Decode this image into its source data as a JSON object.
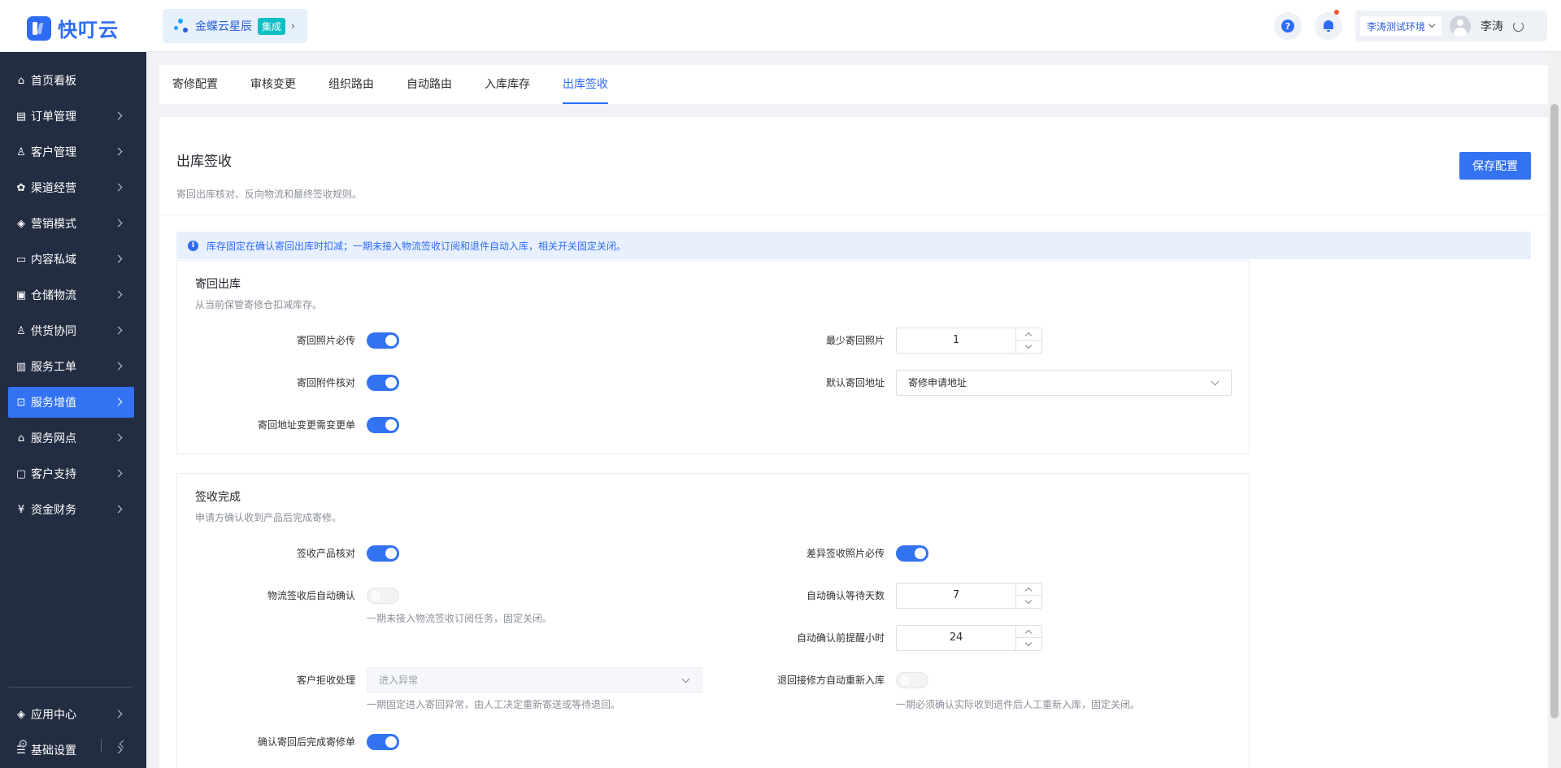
{
  "header": {
    "logo_text": "快叮云",
    "app_name": "金蝶云星辰",
    "app_tag": "集成",
    "env": "李涛测试环境",
    "user": "李涛",
    "colors": {
      "accent": "#3372f1",
      "sidebar_bg": "#232d42",
      "notify_dot": "#f5532d"
    }
  },
  "sidebar": {
    "items": [
      {
        "label": "首页看板",
        "icon": "home-icon"
      },
      {
        "label": "订单管理",
        "icon": "order-icon"
      },
      {
        "label": "客户管理",
        "icon": "user-icon"
      },
      {
        "label": "渠道经营",
        "icon": "channel-icon"
      },
      {
        "label": "营销模式",
        "icon": "tag-icon"
      },
      {
        "label": "内容私域",
        "icon": "image-icon"
      },
      {
        "label": "仓储物流",
        "icon": "box-icon"
      },
      {
        "label": "供货协同",
        "icon": "supply-icon"
      },
      {
        "label": "服务工单",
        "icon": "ticket-icon"
      },
      {
        "label": "服务增值",
        "icon": "bag-icon"
      },
      {
        "label": "服务网点",
        "icon": "store-icon"
      },
      {
        "label": "客户支持",
        "icon": "support-icon"
      },
      {
        "label": "资金财务",
        "icon": "yen-icon"
      }
    ],
    "bottom_items": [
      {
        "label": "应用中心",
        "icon": "cube-icon"
      },
      {
        "label": "基础设置",
        "icon": "settings-list-icon"
      }
    ]
  },
  "tabs": [
    "寄修配置",
    "审核变更",
    "组织路由",
    "自动路由",
    "入库库存",
    "出库签收"
  ],
  "page": {
    "title": "出库签收",
    "description": "寄回出库核对、反向物流和最终签收规则。",
    "save_label": "保存配置",
    "notice": "库存固定在确认寄回出库时扣减；一期未接入物流签收订阅和退件自动入库，相关开关固定关闭。"
  },
  "section1": {
    "title": "寄回出库",
    "description": "从当前保管寄修仓扣减库存。",
    "photo_required_label": "寄回照片必传",
    "photo_required": true,
    "attachment_check_label": "寄回附件核对",
    "attachment_check": true,
    "address_change_label": "寄回地址变更需变更单",
    "address_change": true,
    "min_photos_label": "最少寄回照片",
    "min_photos": "1",
    "default_address_label": "默认寄回地址",
    "default_address": "寄修申请地址"
  },
  "section2": {
    "title": "签收完成",
    "description": "申请方确认收到产品后完成寄修。",
    "product_check_label": "签收产品核对",
    "product_check": true,
    "diff_photo_label": "差异签收照片必传",
    "diff_photo": true,
    "auto_confirm_label": "物流签收后自动确认",
    "auto_confirm": false,
    "auto_confirm_hint": "一期未接入物流签收订阅任务，固定关闭。",
    "wait_days_label": "自动确认等待天数",
    "wait_days": "7",
    "remind_hours_label": "自动确认前提醒小时",
    "remind_hours": "24",
    "reject_label": "客户拒收处理",
    "reject_value": "进入异常",
    "reject_hint": "一期固定进入寄回异常，由人工决定重新寄送或等待退回。",
    "reinbound_label": "退回接修方自动重新入库",
    "reinbound": false,
    "reinbound_hint": "一期必须确认实际收到退件后人工重新入库，固定关闭。",
    "complete_label": "确认寄回后完成寄修单",
    "complete": true
  }
}
